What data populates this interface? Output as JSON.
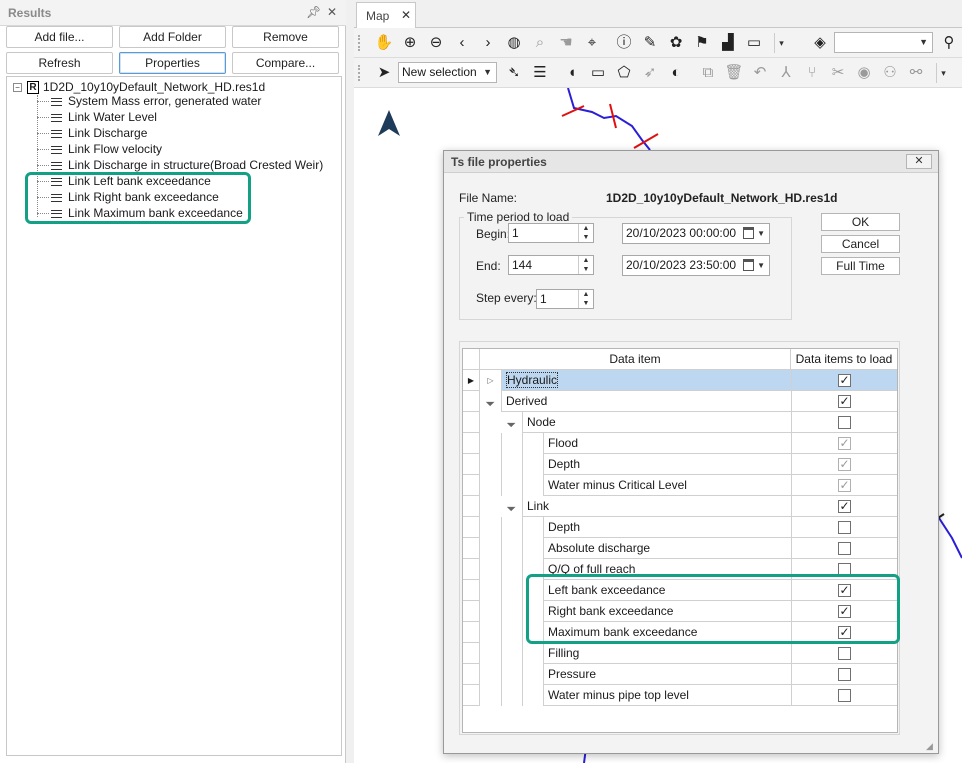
{
  "results_panel": {
    "title": "Results",
    "pin_icon": "pin-icon",
    "close_icon": "close-icon",
    "buttons": {
      "add_file": "Add file...",
      "add_folder": "Add Folder",
      "remove": "Remove",
      "refresh": "Refresh",
      "properties": "Properties",
      "compare": "Compare..."
    },
    "tree": {
      "root_label": "1D2D_10y10yDefault_Network_HD.res1d",
      "root_icon_letter": "R",
      "items": [
        "System Mass error, generated water",
        "Link Water Level",
        "Link Discharge",
        "Link Flow velocity",
        "Link Discharge in structure(Broad Crested Weir)",
        "Link Left bank exceedance",
        "Link Right bank exceedance",
        "Link Maximum bank exceedance"
      ]
    }
  },
  "map": {
    "tab_label": "Map",
    "selection_mode": "New selection"
  },
  "dialog": {
    "title": "Ts file properties",
    "file_name_label": "File Name:",
    "file_name": "1D2D_10y10yDefault_Network_HD.res1d",
    "time_period_label": "Time period  to load",
    "begin_label": "Begin:",
    "begin_value": "1",
    "end_label": "End:",
    "end_value": "144",
    "step_label": "Step every:",
    "step_value": "1",
    "begin_date": "20/10/2023 00:00:00",
    "end_date": "20/10/2023 23:50:00",
    "ok_label": "OK",
    "cancel_label": "Cancel",
    "full_time_label": "Full Time",
    "grid": {
      "col_item": "Data item",
      "col_load": "Data items to load",
      "rows": [
        {
          "label": "Hydraulic",
          "level": 0,
          "caret": "right",
          "checked": true,
          "gray": false,
          "selected": true
        },
        {
          "label": "Derived",
          "level": 0,
          "caret": "down",
          "checked": true,
          "gray": false,
          "selected": false
        },
        {
          "label": "Node",
          "level": 1,
          "caret": "down",
          "checked": false,
          "gray": false,
          "selected": false
        },
        {
          "label": "Flood",
          "level": 2,
          "caret": "",
          "checked": true,
          "gray": true,
          "selected": false
        },
        {
          "label": "Depth",
          "level": 2,
          "caret": "",
          "checked": true,
          "gray": true,
          "selected": false
        },
        {
          "label": "Water minus Critical Level",
          "level": 2,
          "caret": "",
          "checked": true,
          "gray": true,
          "selected": false
        },
        {
          "label": "Link",
          "level": 1,
          "caret": "down",
          "checked": true,
          "gray": false,
          "selected": false
        },
        {
          "label": "Depth",
          "level": 2,
          "caret": "",
          "checked": false,
          "gray": false,
          "selected": false
        },
        {
          "label": "Absolute discharge",
          "level": 2,
          "caret": "",
          "checked": false,
          "gray": false,
          "selected": false
        },
        {
          "label": "Q/Q of full reach",
          "level": 2,
          "caret": "",
          "checked": false,
          "gray": false,
          "selected": false
        },
        {
          "label": "Left bank exceedance",
          "level": 2,
          "caret": "",
          "checked": true,
          "gray": false,
          "selected": false
        },
        {
          "label": "Right bank exceedance",
          "level": 2,
          "caret": "",
          "checked": true,
          "gray": false,
          "selected": false
        },
        {
          "label": "Maximum bank exceedance",
          "level": 2,
          "caret": "",
          "checked": true,
          "gray": false,
          "selected": false
        },
        {
          "label": "Filling",
          "level": 2,
          "caret": "",
          "checked": false,
          "gray": false,
          "selected": false
        },
        {
          "label": "Pressure",
          "level": 2,
          "caret": "",
          "checked": false,
          "gray": false,
          "selected": false
        },
        {
          "label": "Water minus pipe top level",
          "level": 2,
          "caret": "",
          "checked": false,
          "gray": false,
          "selected": false
        }
      ]
    }
  },
  "colors": {
    "highlight": "#14a085",
    "network_line": "#2a1fd6",
    "cross_mark": "#e01010",
    "north_arrow": "#1f3b5a"
  }
}
